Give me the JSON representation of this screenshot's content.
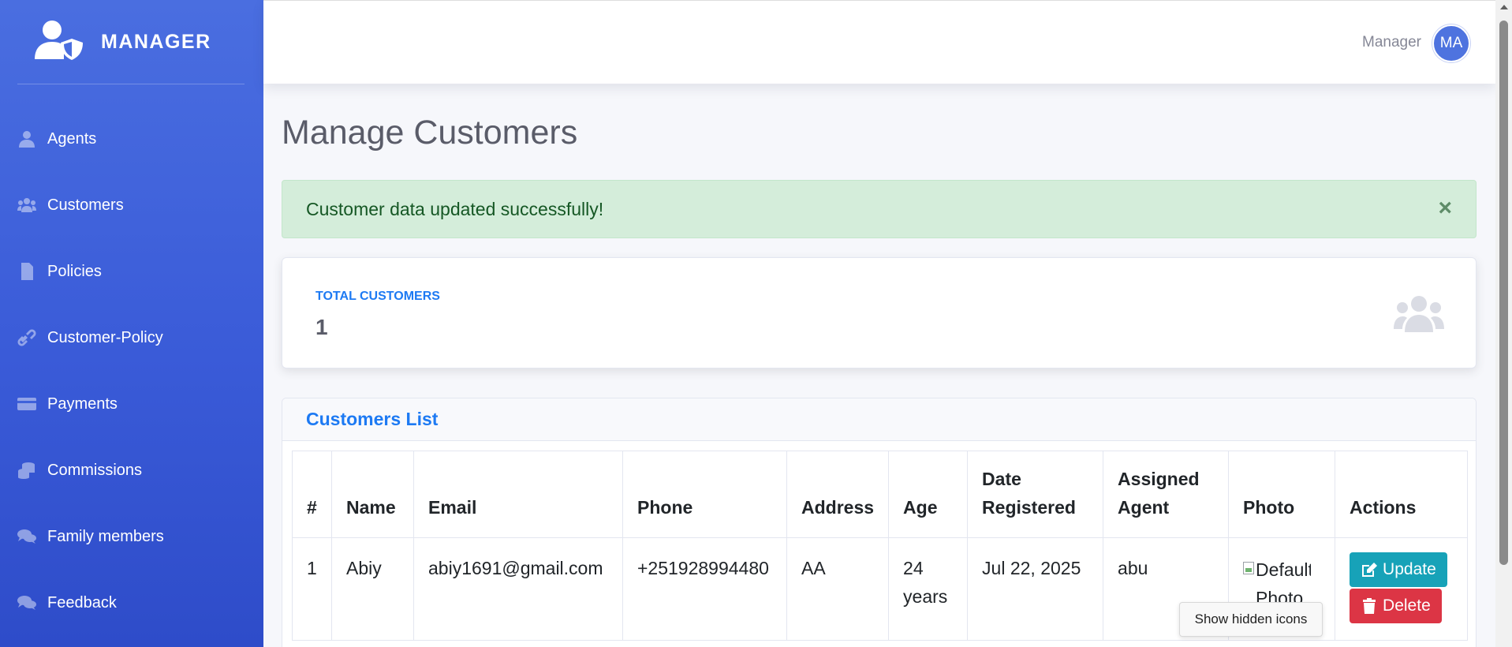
{
  "brand": {
    "title": "MANAGER",
    "icon": "user-shield-icon"
  },
  "sidebar": {
    "items": [
      {
        "label": "Agents",
        "icon": "user-tie-icon"
      },
      {
        "label": "Customers",
        "icon": "users-icon"
      },
      {
        "label": "Policies",
        "icon": "file-icon"
      },
      {
        "label": "Customer-Policy",
        "icon": "link-icon"
      },
      {
        "label": "Payments",
        "icon": "credit-card-icon"
      },
      {
        "label": "Commissions",
        "icon": "coins-icon"
      },
      {
        "label": "Family members",
        "icon": "comments-icon"
      },
      {
        "label": "Feedback",
        "icon": "comments-icon"
      }
    ]
  },
  "topbar": {
    "user_name": "Manager",
    "avatar_initials": "MA"
  },
  "page": {
    "title": "Manage Customers"
  },
  "alert": {
    "message": "Customer data updated successfully!",
    "close": "×"
  },
  "stats": {
    "label": "Total Customers",
    "value": "1",
    "icon": "users-icon"
  },
  "list": {
    "title": "Customers List",
    "columns": [
      "#",
      "Name",
      "Email",
      "Phone",
      "Address",
      "Age",
      "Date Registered",
      "Assigned Agent",
      "Photo",
      "Actions"
    ],
    "rows": [
      {
        "num": "1",
        "name": "Abiy",
        "email": "abiy1691@gmail.com",
        "phone": "+251928994480",
        "address": "AA",
        "age": "24 years",
        "date": "Jul 22, 2025",
        "agent": "abu",
        "photo_alt": "Default Photo",
        "update_label": "Update",
        "delete_label": "Delete"
      }
    ]
  },
  "tooltip": {
    "text": "Show hidden icons"
  },
  "colors": {
    "sidebar": "#4a6ee0",
    "accent": "#1d7af3",
    "success_bg": "#d4edda",
    "update": "#17a2b8",
    "delete": "#dc3545"
  }
}
